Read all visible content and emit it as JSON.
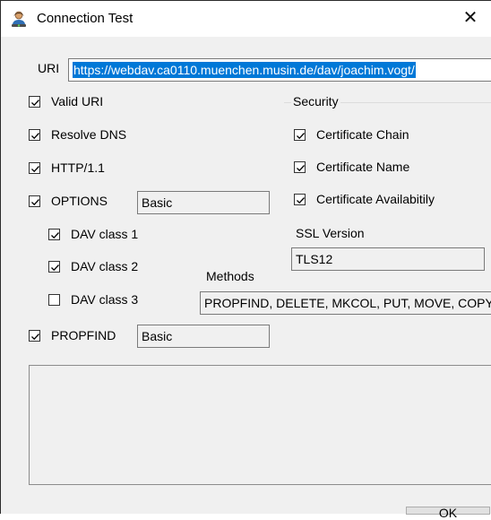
{
  "window": {
    "title": "Connection Test",
    "close_label": "✕"
  },
  "uri": {
    "label": "URI",
    "value": "https://webdav.ca0110.muenchen.musin.de/dav/joachim.vogt/"
  },
  "checks": {
    "valid_uri": {
      "label": "Valid URI",
      "checked": true
    },
    "resolve_dns": {
      "label": "Resolve DNS",
      "checked": true
    },
    "http11": {
      "label": "HTTP/1.1",
      "checked": true
    },
    "options": {
      "label": "OPTIONS",
      "checked": true,
      "auth": "Basic"
    },
    "dav_class_1": {
      "label": "DAV class 1",
      "checked": true
    },
    "dav_class_2": {
      "label": "DAV class 2",
      "checked": true
    },
    "dav_class_3": {
      "label": "DAV class 3",
      "checked": false
    },
    "propfind": {
      "label": "PROPFIND",
      "checked": true,
      "auth": "Basic"
    }
  },
  "methods": {
    "label": "Methods",
    "value": "PROPFIND, DELETE, MKCOL, PUT, MOVE, COPY"
  },
  "security": {
    "label": "Security",
    "certificate_chain": {
      "label": "Certificate Chain",
      "checked": true
    },
    "certificate_name": {
      "label": "Certificate Name",
      "checked": true
    },
    "certificate_availability": {
      "label": "Certificate Availabitily",
      "checked": true
    },
    "ssl_version_label": "SSL Version",
    "ssl_version": "TLS12"
  },
  "log": {
    "text": ""
  },
  "buttons": {
    "ok": "OK"
  },
  "icons": {
    "title": "user-network-icon",
    "check": "checkmark-icon"
  }
}
